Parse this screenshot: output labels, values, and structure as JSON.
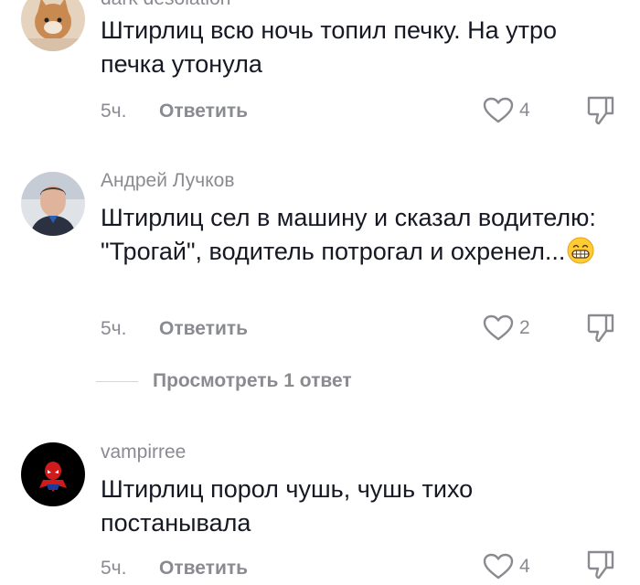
{
  "comments": [
    {
      "username": "dark desolation",
      "text": "Штирлиц всю ночь топил печку. На утро печка утонула",
      "time": "5ч.",
      "reply_label": "Ответить",
      "likes": "4",
      "avatar_icon": "cat-avatar"
    },
    {
      "username": "Андрей Лучков",
      "text": "Штирлиц сел в машину и сказал водителю: \"Трогай\", водитель потрогал и охренел...",
      "emoji": "grinning-face-emoji",
      "time": "5ч.",
      "reply_label": "Ответить",
      "likes": "2",
      "avatar_icon": "man-photo-avatar",
      "view_replies_label": "Просмотреть 1 ответ"
    },
    {
      "username": "vampirree",
      "text": "Штирлиц порол чушь, чушь тихо постанывала",
      "time": "5ч.",
      "reply_label": "Ответить",
      "likes": "4",
      "avatar_icon": "spiderman-avatar"
    }
  ],
  "colors": {
    "text": "#161823",
    "secondary": "#8a8b91",
    "background": "#ffffff"
  }
}
